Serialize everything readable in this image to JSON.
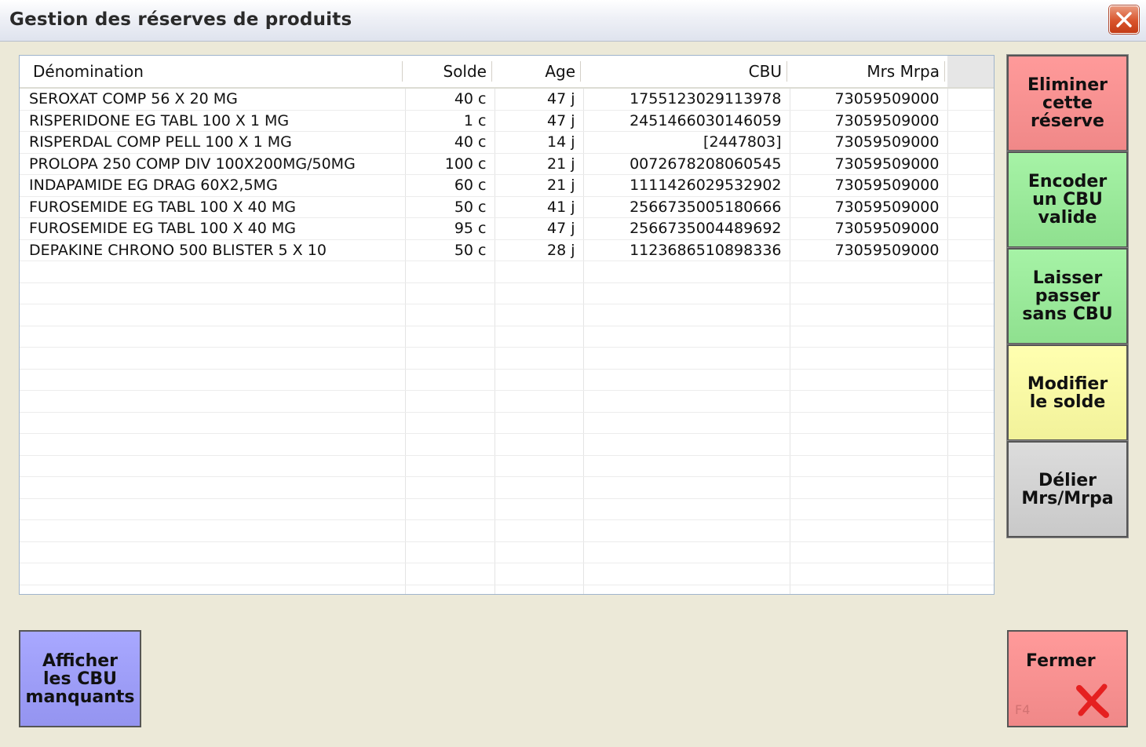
{
  "window": {
    "title": "Gestion des réserves de produits"
  },
  "grid": {
    "columns": [
      "Dénomination",
      "Solde",
      "Age",
      "CBU",
      "Mrs Mrpa"
    ],
    "rows": [
      [
        "SEROXAT COMP 56 X 20 MG",
        "40 c",
        "47 j",
        "1755123029113978",
        "73059509000"
      ],
      [
        "RISPERIDONE EG TABL 100 X 1 MG",
        "1 c",
        "47 j",
        "2451466030146059",
        "73059509000"
      ],
      [
        "RISPERDAL COMP PELL 100 X 1 MG",
        "40 c",
        "14 j",
        "[2447803]",
        "73059509000"
      ],
      [
        "PROLOPA 250 COMP DIV 100X200MG/50MG",
        "100 c",
        "21 j",
        "0072678208060545",
        "73059509000"
      ],
      [
        "INDAPAMIDE EG DRAG 60X2,5MG",
        "60 c",
        "21 j",
        "1111426029532902",
        "73059509000"
      ],
      [
        "FUROSEMIDE EG TABL 100 X 40 MG",
        "50 c",
        "41 j",
        "2566735005180666",
        "73059509000"
      ],
      [
        "FUROSEMIDE EG TABL 100 X 40 MG",
        "95 c",
        "47 j",
        "2566735004489692",
        "73059509000"
      ],
      [
        "DEPAKINE CHRONO 500 BLISTER 5 X 10",
        "50 c",
        "28 j",
        "1123686510898336",
        "73059509000"
      ]
    ],
    "empty_rows": 16
  },
  "actions": {
    "eliminer": "Eliminer\ncette\nréserve",
    "encoder": "Encoder\nun CBU\nvalide",
    "laisser": "Laisser\npasser\nsans CBU",
    "modifier": "Modifier\nle solde",
    "delier": "Délier\nMrs/Mrpa",
    "afficher": "Afficher\nles CBU\nmanquants",
    "fermer": "Fermer",
    "fermer_key": "F4"
  },
  "colors": {
    "red": "#f59090",
    "green": "#99e899",
    "yellow": "#f8f8a4",
    "gray": "#d2d2d2",
    "blue": "#9e9ef6"
  },
  "icons": {
    "close": "close-icon",
    "fermer": "red-x-icon"
  }
}
